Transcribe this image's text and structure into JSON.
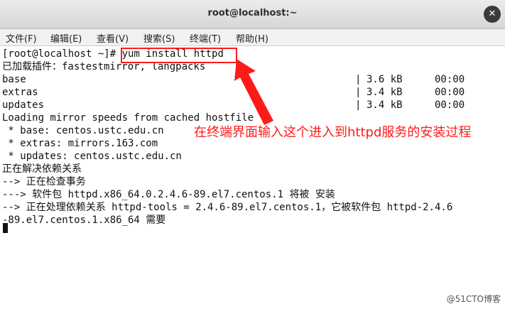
{
  "window": {
    "title": "root@localhost:~",
    "close_glyph": "✕"
  },
  "menu": [
    "文件(F)",
    "编辑(E)",
    "查看(V)",
    "搜索(S)",
    "终端(T)",
    "帮助(H)"
  ],
  "terminal": {
    "prompt": "[root@localhost ~]# ",
    "command": "yum install httpd",
    "plugins_line": "已加载插件：fastestmirror, langpacks",
    "repos": [
      {
        "name": "base",
        "size": "3.6 kB",
        "time": "00:00"
      },
      {
        "name": "extras",
        "size": "3.4 kB",
        "time": "00:00"
      },
      {
        "name": "updates",
        "size": "3.4 kB",
        "time": "00:00"
      }
    ],
    "mirror_line": "Loading mirror speeds from cached hostfile",
    "mirrors": [
      " * base: centos.ustc.edu.cn",
      " * extras: mirrors.163.com",
      " * updates: centos.ustc.edu.cn"
    ],
    "resolve_lines": [
      "正在解决依赖关系",
      "--> 正在检查事务",
      "---> 软件包 httpd.x86_64.0.2.4.6-89.el7.centos.1 将被 安装",
      "--> 正在处理依赖关系 httpd-tools = 2.4.6-89.el7.centos.1，它被软件包 httpd-2.4.6",
      "-89.el7.centos.1.x86_64 需要"
    ]
  },
  "annotation": "在终端界面输入这个进入到httpd服务的安装过程",
  "watermark": "@51CTO博客",
  "colors": {
    "annotation": "#ff1a1a"
  }
}
